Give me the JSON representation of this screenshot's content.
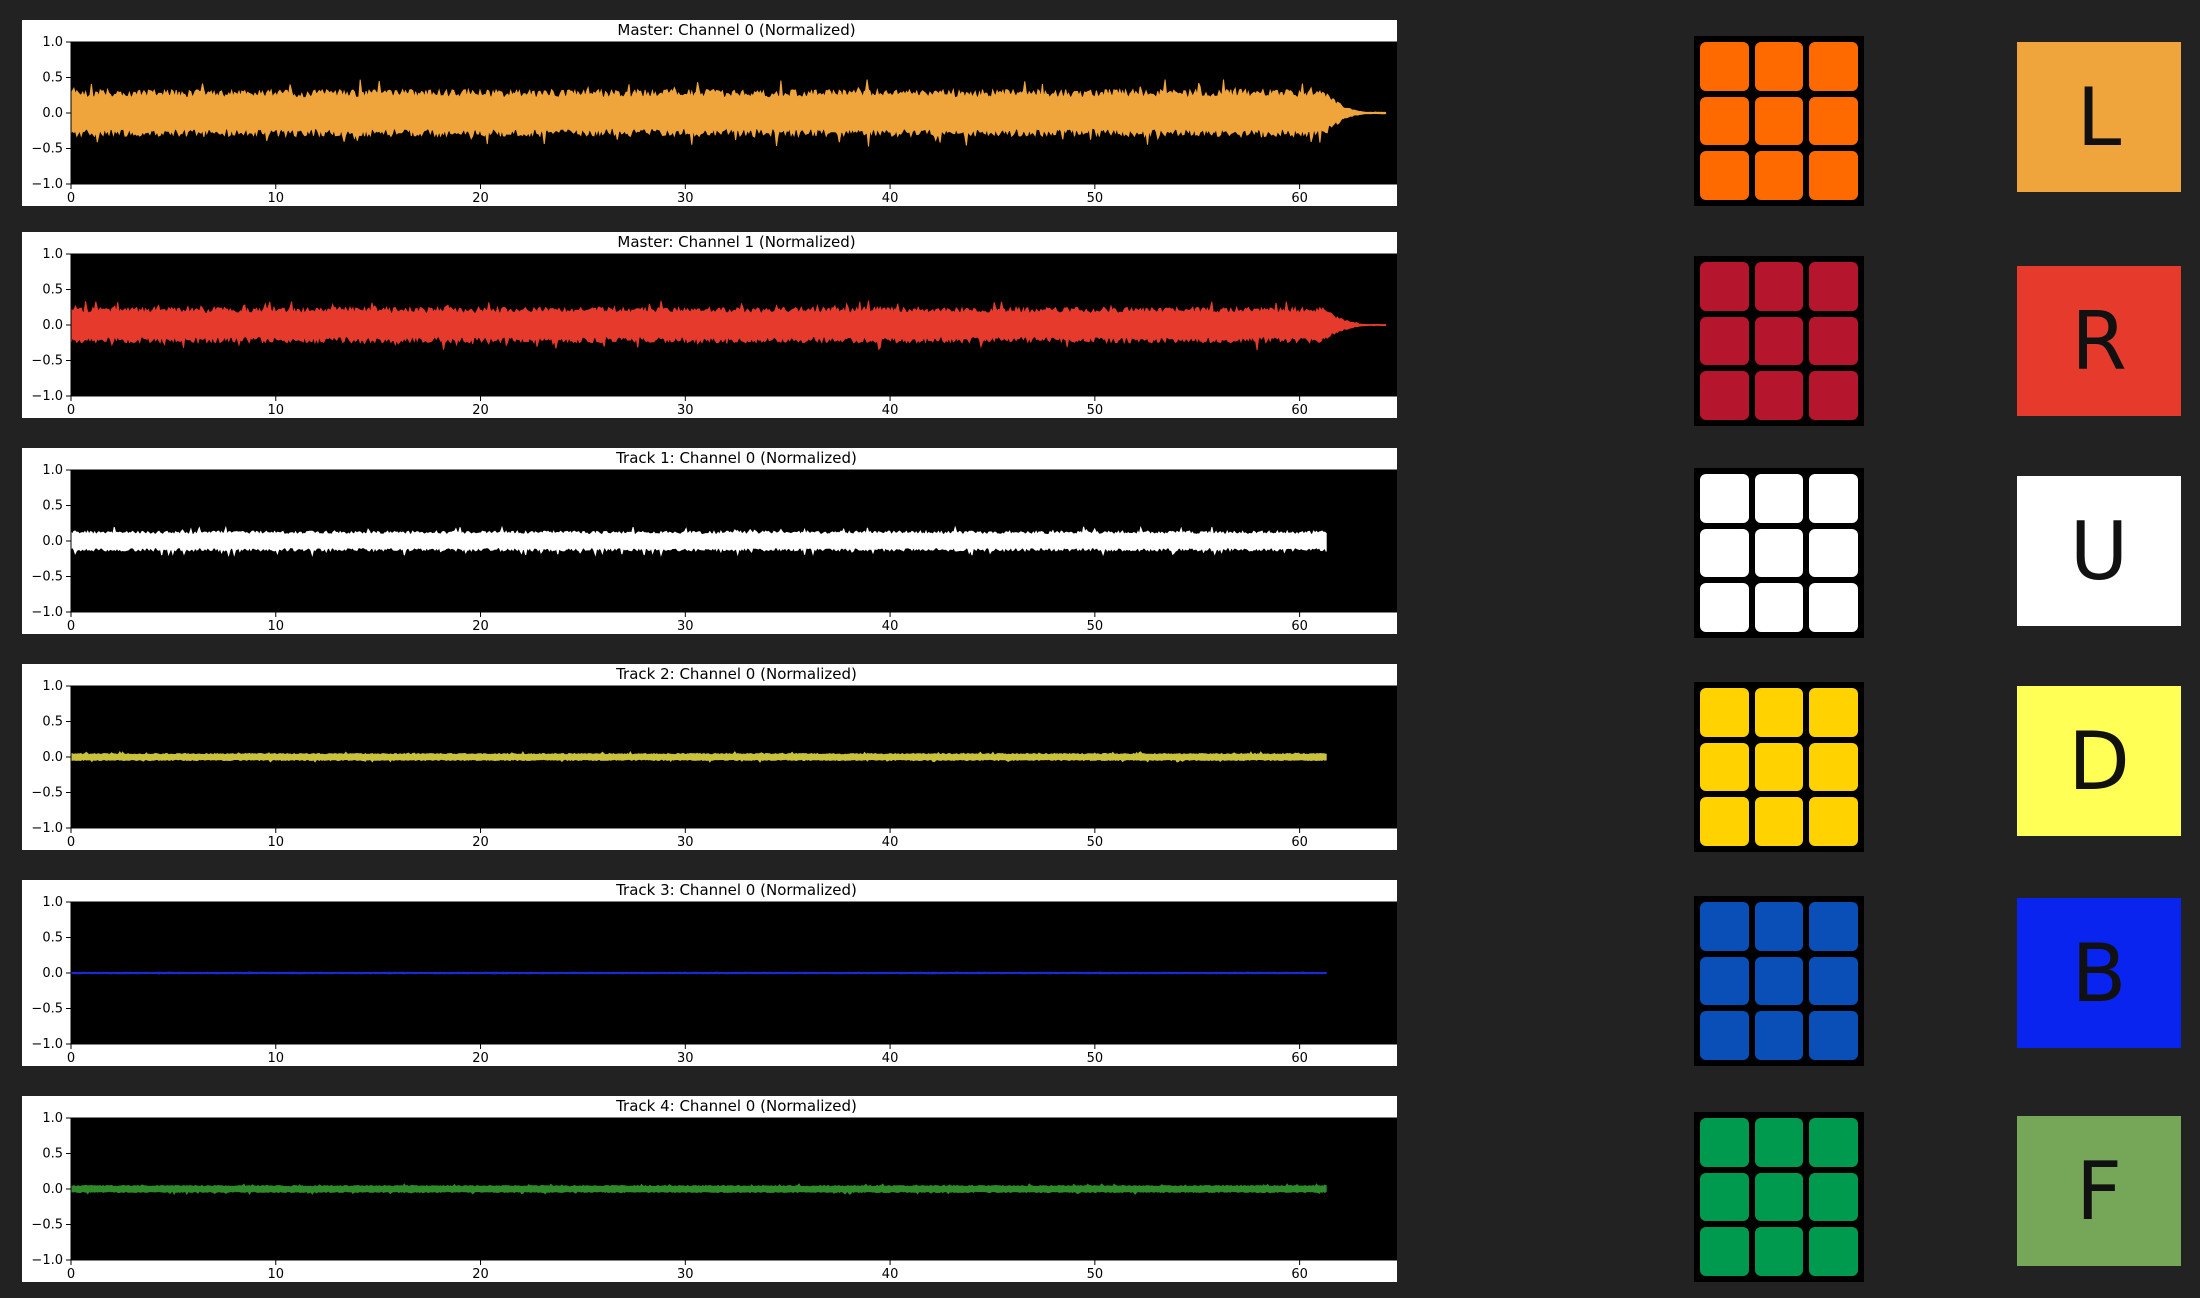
{
  "chart_data": [
    {
      "type": "line",
      "title": "Master: Channel 0 (Normalized)",
      "color": "#f0a53c",
      "xlim": [
        0,
        65
      ],
      "ylim": [
        -1.0,
        1.0
      ],
      "end_x": 64.2,
      "fade_start": 61.2,
      "amp": 0.33,
      "spike": 0.47,
      "xticks": [
        0,
        10,
        20,
        30,
        40,
        50,
        60
      ],
      "yticks": [
        "1.0",
        "0.5",
        "0.0",
        "−0.5",
        "−1.0"
      ]
    },
    {
      "type": "line",
      "title": "Master: Channel 1 (Normalized)",
      "color": "#e53a2c",
      "xlim": [
        0,
        65
      ],
      "ylim": [
        -1.0,
        1.0
      ],
      "end_x": 64.2,
      "fade_start": 61.2,
      "amp": 0.25,
      "spike": 0.4,
      "xticks": [
        0,
        10,
        20,
        30,
        40,
        50,
        60
      ],
      "yticks": [
        "1.0",
        "0.5",
        "0.0",
        "−0.5",
        "−1.0"
      ]
    },
    {
      "type": "line",
      "title": "Track 1: Channel 0 (Normalized)",
      "color": "#ffffff",
      "xlim": [
        0,
        65
      ],
      "ylim": [
        -1.0,
        1.0
      ],
      "end_x": 61.3,
      "fade_start": null,
      "amp": 0.14,
      "spike": 0.2,
      "xticks": [
        0,
        10,
        20,
        30,
        40,
        50,
        60
      ],
      "yticks": [
        "1.0",
        "0.5",
        "0.0",
        "−0.5",
        "−1.0"
      ]
    },
    {
      "type": "line",
      "title": "Track 2: Channel 0 (Normalized)",
      "color": "#c9c23a",
      "xlim": [
        0,
        65
      ],
      "ylim": [
        -1.0,
        1.0
      ],
      "end_x": 61.3,
      "fade_start": null,
      "amp": 0.05,
      "spike": 0.18,
      "xticks": [
        0,
        10,
        20,
        30,
        40,
        50,
        60
      ],
      "yticks": [
        "1.0",
        "0.5",
        "0.0",
        "−0.5",
        "−1.0"
      ]
    },
    {
      "type": "line",
      "title": "Track 3: Channel 0 (Normalized)",
      "color": "#1a2bd6",
      "xlim": [
        0,
        65
      ],
      "ylim": [
        -1.0,
        1.0
      ],
      "end_x": 61.3,
      "fade_start": null,
      "amp": 0.01,
      "spike": 0.015,
      "xticks": [
        0,
        10,
        20,
        30,
        40,
        50,
        60
      ],
      "yticks": [
        "1.0",
        "0.5",
        "0.0",
        "−0.5",
        "−1.0"
      ]
    },
    {
      "type": "line",
      "title": "Track 4: Channel 0 (Normalized)",
      "color": "#2f8a2a",
      "xlim": [
        0,
        65
      ],
      "ylim": [
        -1.0,
        1.0
      ],
      "end_x": 61.3,
      "fade_start": null,
      "amp": 0.05,
      "spike": 0.1,
      "xticks": [
        0,
        10,
        20,
        30,
        40,
        50,
        60
      ],
      "yticks": [
        "1.0",
        "0.5",
        "0.0",
        "−0.5",
        "−1.0"
      ]
    }
  ],
  "faces": [
    {
      "letter": "L",
      "sticker_color": "#ff6a00",
      "tile_color": "#f0a53c"
    },
    {
      "letter": "R",
      "sticker_color": "#b5162e",
      "tile_color": "#e53a2c"
    },
    {
      "letter": "U",
      "sticker_color": "#ffffff",
      "tile_color": "#ffffff"
    },
    {
      "letter": "D",
      "sticker_color": "#ffd200",
      "tile_color": "#ffff55"
    },
    {
      "letter": "B",
      "sticker_color": "#0a4fb8",
      "tile_color": "#0a24f0"
    },
    {
      "letter": "F",
      "sticker_color": "#009a4e",
      "tile_color": "#76a657"
    }
  ]
}
